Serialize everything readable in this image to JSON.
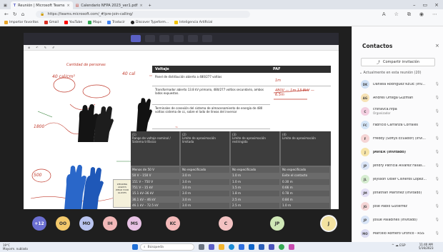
{
  "browser": {
    "tabs": [
      {
        "label": "Reunión | Microsoft Teams",
        "active": true
      },
      {
        "label": "Calendario NFPA 2023_ver1.pdf",
        "active": false
      }
    ],
    "new_tab": "+",
    "url": "https://teams.microsoft.com/_#/pre-join-calling/",
    "bookmarks": [
      {
        "label": "Importar favoritos",
        "color": "#e8a42a"
      },
      {
        "label": "Gmail",
        "color": "#d93025"
      },
      {
        "label": "YouTube",
        "color": "#ff0000"
      },
      {
        "label": "Maps",
        "color": "#34a853"
      },
      {
        "label": "Traducir",
        "color": "#4285f4"
      },
      {
        "label": "Discover Typeform...",
        "color": "#222222"
      },
      {
        "label": "Inteligencia Artificial",
        "color": "#f2c200"
      }
    ]
  },
  "slide": {
    "col1_header": "Voltaje",
    "col2_header": "PAF",
    "rows": [
      {
        "text": "Panel de distribución abierto a 480/277 voltios",
        "note": "1m"
      },
      {
        "text": "Transformador abierto 13.8 kV primario, 480/277 voltios secundario, ambos lados expuestos.",
        "note": "480V — 1m   13.8kV — 6.5m"
      },
      {
        "text": "Terminales de conexión del sistema de almacenamiento de energía de 480 voltios sistema de cc, sobre el lado de líneas del inversor",
        "note": ""
      }
    ],
    "handwritten_labels": [
      "40 cal/cm²",
      "Cantidad de personas",
      "1800",
      "500",
      "40 cal"
    ],
    "glove_labels": [
      "WEARING",
      "ALWAYS",
      "WEAR YOUR GLOVES"
    ],
    "table_headers": [
      {
        "num": "(1)",
        "text": "Rango de voltaje nominal / Sistema trifásico"
      },
      {
        "num": "(2)",
        "text": "Límite de aproximación limitada"
      },
      {
        "num": "(3)",
        "text": "Límite de aproximación restringida"
      },
      {
        "num": "(4)",
        "text": "Límite de aproximación"
      }
    ],
    "table_rows": [
      [
        "Menos de 50 V",
        "No especificado",
        "No especificado",
        "No especificado"
      ],
      [
        "50 V – 150 V",
        "3.0 m",
        "1.0 m",
        "Evite el contacto"
      ],
      [
        "151 V – 750 V",
        "3.0 m",
        "1.0 m",
        "0.30 m"
      ],
      [
        "751 V – 15 kV",
        "3.0 m",
        "1.5 m",
        "0.66 m"
      ],
      [
        "15.1 kV–36 kV",
        "3.0 m",
        "1.8 m",
        "0.78 m"
      ],
      [
        "36.1 kV – 46 kV",
        "3.0 m",
        "2.5 m",
        "0.84 m"
      ],
      [
        "46.1 kV – 72.5 kV",
        "3.0 m",
        "2.5 m",
        "1.0 m"
      ],
      [
        "72.6 kV – 121 kV",
        "3.3 m",
        "2.5 m",
        "1.06 m"
      ]
    ]
  },
  "participants_row": [
    {
      "initials": "+12",
      "color": "#6b6fd1",
      "text_color": "#ffffff"
    },
    {
      "initials": "OO",
      "color": "#f3c96b",
      "text_color": "#333333"
    },
    {
      "initials": "MO",
      "color": "#b9c4f0",
      "text_color": "#333333"
    },
    {
      "initials": "IH",
      "color": "#f2b8b8",
      "text_color": "#333333"
    },
    {
      "initials": "MS",
      "color": "#e7c1e4",
      "text_color": "#333333"
    },
    {
      "initials": "KC",
      "color": "#f3b9b9",
      "text_color": "#333333"
    },
    {
      "initials": "C",
      "color": "#f3c2c2",
      "text_color": "#333333"
    },
    {
      "initials": "JP",
      "color": "#cfe7b6",
      "text_color": "#333333"
    },
    {
      "initials": "J",
      "color": "#f3e2a0",
      "text_color": "#333333"
    }
  ],
  "panel": {
    "title": "Contactos",
    "close": "×",
    "invite_label": "Compartir invitación",
    "section_label": "Actualmente en esta reunión (20)",
    "people": [
      {
        "initials": "DK",
        "name": "Daniela Rodríguez KEOE (Inv...",
        "sub": "",
        "color": "#cfe0f5",
        "bold": false
      },
      {
        "initials": "AG",
        "name": "Andrés Ortega Guzman",
        "sub": "",
        "color": "#f6e2b5",
        "bold": false
      },
      {
        "initials": "C",
        "name": "crsnavca.nfpa",
        "sub": "Organizador",
        "color": "#f3cfe0",
        "bold": false
      },
      {
        "initials": "FC",
        "name": "Fabricio Carranza Corrales",
        "sub": "",
        "color": "#d5e6f8",
        "bold": false
      },
      {
        "initials": "F",
        "name": "Freddy (Softys Ecuador) (Invi...",
        "sub": "",
        "color": "#f5d4d4",
        "bold": false
      },
      {
        "initials": "J",
        "name": "JAVIER (Invitado)",
        "sub": "",
        "color": "#f6e4a8",
        "bold": true
      },
      {
        "initials": "JP",
        "name": "Jendry Patricia Álvarez Fallas...",
        "sub": "",
        "color": "#dbe5f6",
        "bold": false
      },
      {
        "initials": "JL",
        "name": "Jeysson Odier Cisneros López...",
        "sub": "",
        "color": "#d6ecd0",
        "bold": false
      },
      {
        "initials": "JM",
        "name": "Jonathan Martínez (Invitado)",
        "sub": "",
        "color": "#e4e0f5",
        "bold": false
      },
      {
        "initials": "JG",
        "name": "Jose Pablo Gutierrez",
        "sub": "",
        "color": "#f5d6d6",
        "bold": false
      },
      {
        "initials": "JP",
        "name": "Josué Paladines (Invitado)",
        "sub": "",
        "color": "#d8e4f6",
        "bold": false
      },
      {
        "initials": "MO",
        "name": "Marcelo Romero Oroñco - RSS",
        "sub": "",
        "color": "#dcdcf2",
        "bold": false
      }
    ]
  },
  "taskbar": {
    "weather_temp": "19°C",
    "weather_desc": "Mayorm. nublado",
    "search_label": "Búsqueda",
    "lang": "ESP\nLAA",
    "time": "11:40 AM",
    "date": "5/16/2023"
  }
}
